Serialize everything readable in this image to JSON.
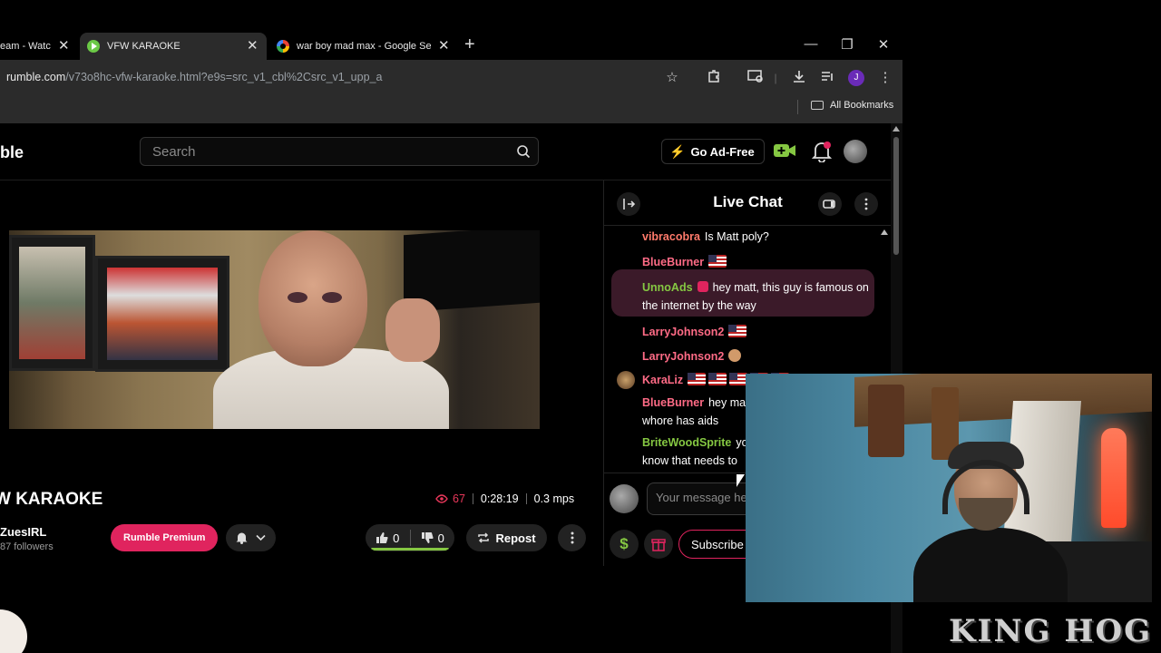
{
  "browser": {
    "tabs": [
      {
        "title": "eam - Watc",
        "active": false,
        "favicon": "rumble-favicon-partial"
      },
      {
        "title": "VFW KARAOKE",
        "active": true,
        "favicon": "rumble-favicon"
      },
      {
        "title": "war boy mad max - Google Sea",
        "active": false,
        "favicon": "google-favicon"
      }
    ],
    "url_host": "rumble.com",
    "url_path": "/v73o8hc-vfw-karaoke.html?e9s=src_v1_cbl%2Csrc_v1_upp_a",
    "bookmarks_label": "All Bookmarks",
    "profile_initial": "J"
  },
  "header": {
    "logo_text": "ble",
    "search_placeholder": "Search",
    "ad_free_label": "Go Ad-Free"
  },
  "video": {
    "title": "W KARAOKE",
    "viewers": "67",
    "duration": "0:28:19",
    "speed": "0.3 mps",
    "channel": "ZuesIRL",
    "followers": "87 followers",
    "premium_label": "Rumble Premium",
    "likes": "0",
    "dislikes": "0",
    "like_ratio": 1.0,
    "repost_label": "Repost"
  },
  "chat": {
    "title": "Live Chat",
    "messages": [
      {
        "user": "vibracobra",
        "text": "Is Matt poly?",
        "color": "#ff7a6b"
      },
      {
        "user": "BlueBurner",
        "text": "",
        "color": "#ff6b86",
        "flags": 1
      },
      {
        "user": "UnnoAds",
        "text": "hey matt, this guy is famous on the internet by the way",
        "color": "#85c742",
        "highlight": true
      },
      {
        "user": "LarryJohnson2",
        "text": "",
        "color": "#ff6b86",
        "flags": 1
      },
      {
        "user": "LarryJohnson2",
        "text": "",
        "color": "#ff6b86",
        "emoji": true
      },
      {
        "user": "KaraLiz",
        "text": "",
        "color": "#ff6b86",
        "flags": 5
      },
      {
        "user": "BlueBurner",
        "text": "hey ma",
        "text2": "whore has aids",
        "color": "#ff6b86"
      },
      {
        "user": "BriteWoodSprite",
        "text": "yo",
        "text2": "know that needs to",
        "color": "#85c742"
      }
    ],
    "input_placeholder": "Your message here",
    "subscribe_label": "Subscribe"
  },
  "overlay": {
    "watermark": "KING HOG"
  },
  "colors": {
    "accent_green": "#85c742",
    "accent_pink": "#e0245e",
    "highlight_bg": "#3b1a29"
  }
}
